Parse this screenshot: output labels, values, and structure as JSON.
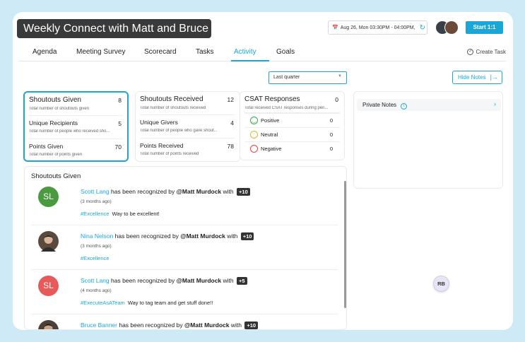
{
  "header": {
    "title": "Weekly Connect with Matt and Bruce",
    "date_range": "Aug 26, Mon  03:30PM - 04:00PM,",
    "start_label": "Start 1:1"
  },
  "tabs": [
    "Agenda",
    "Meeting Survey",
    "Scorecard",
    "Tasks",
    "Activity",
    "Goals"
  ],
  "active_tab": "Activity",
  "create_task": "Create Task",
  "filter": {
    "selected": "Last quarter"
  },
  "hide_notes": "Hide Notes",
  "cards": {
    "given": [
      {
        "label": "Shoutouts Given",
        "value": "8",
        "sub": "Total number of shoutouts given"
      },
      {
        "label": "Unique Recipients",
        "value": "5",
        "sub": "Total number of people who received sho..."
      },
      {
        "label": "Points Given",
        "value": "70",
        "sub": "Total number of points given"
      }
    ],
    "received": [
      {
        "label": "Shoutouts Received",
        "value": "12",
        "sub": "Total number of shoutouts received"
      },
      {
        "label": "Unique Givers",
        "value": "4",
        "sub": "Total number of people who gave shout..."
      },
      {
        "label": "Points Received",
        "value": "78",
        "sub": "Total number of points received"
      }
    ],
    "csat": {
      "label": "CSAT Responses",
      "value": "0",
      "sub": "Total received CSAT responses during peri...",
      "rows": [
        {
          "label": "Positive",
          "value": "0"
        },
        {
          "label": "Neutral",
          "value": "0"
        },
        {
          "label": "Negative",
          "value": "0"
        }
      ]
    }
  },
  "notes": {
    "title": "Private Notes"
  },
  "feed": {
    "title": "Shoutouts Given",
    "items": [
      {
        "initials": "SL",
        "name": "Scott Lang",
        "mid": " has been recognized by ",
        "by": "@Matt Murdock",
        "with": " with ",
        "points": "+10",
        "ago": "(3 months ago)",
        "tag": "#Excellence",
        "message": "Way to be excellent!"
      },
      {
        "initials": "",
        "name": "Nina Nelson",
        "mid": " has been recognized by ",
        "by": "@Matt Murdock",
        "with": " with ",
        "points": "+10",
        "ago": "(3 months ago)",
        "tag": "#Excellence",
        "message": ""
      },
      {
        "initials": "SL",
        "name": "Scott Lang",
        "mid": " has been recognized by ",
        "by": "@Matt Murdock",
        "with": " with ",
        "points": "+5",
        "ago": "(4 months ago)",
        "tag": "#ExecuteAsATeam",
        "message": "Way to tag team and get stuff done!!"
      },
      {
        "initials": "",
        "name": "Bruce Banner",
        "mid": " has been recognized by ",
        "by": "@Matt Murdock",
        "with": " with ",
        "points": "+10",
        "ago": "",
        "tag": "",
        "message": ""
      }
    ]
  },
  "floating_avatar": "RB",
  "colors": {
    "accent": "#1aa7d8",
    "avatar_green": "#4a9a3f",
    "avatar_red": "#e85a5a",
    "title_bg": "#3a3a3a"
  }
}
